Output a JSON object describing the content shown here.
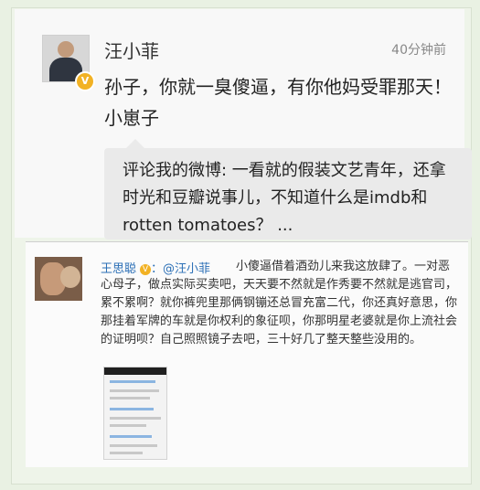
{
  "post1": {
    "username": "汪小菲",
    "time": "40分钟前",
    "content": "孙子，你就一臭傻逼，有你他妈受罪那天！小崽子",
    "quote": "评论我的微博: 一看就的假装文艺青年，还拿时光和豆瓣说事儿，不知道什么是imdb和rotten tomatoes？ ..."
  },
  "post2": {
    "username": "王思聪",
    "mention": "@汪小菲",
    "content": "小傻逼借着酒劲儿来我这放肆了。一对恶心母子，做点实际买卖吧，天天要不然就是作秀要不然就是逃官司，累不累啊？就你裤兜里那俩钢镚还总冒充富二代，你还真好意思，你那挂着军牌的车就是你权利的象征呗，你那明星老婆就是你上流社会的证明呗？自己照照镜子去吧，三十好几了整天整些没用的。"
  },
  "icons": {
    "verified": "verified-v-badge"
  },
  "colors": {
    "link": "#2b6fb6",
    "badge": "#f2b224",
    "frame": "#eef4e9"
  }
}
